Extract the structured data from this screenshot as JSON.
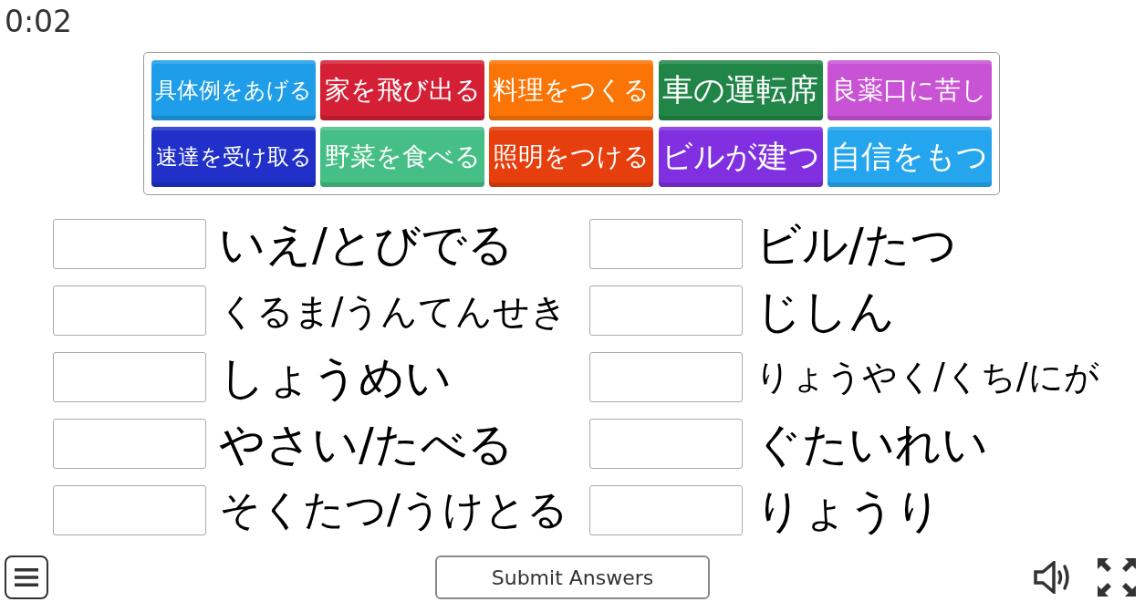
{
  "timer": "0:02",
  "tiles": [
    {
      "label": "具体例をあげる",
      "color": "#1e9de8"
    },
    {
      "label": "家を飛び出る",
      "color": "#d41f35"
    },
    {
      "label": "料理をつくる",
      "color": "#fb7406"
    },
    {
      "label": "車の運転席",
      "color": "#218548"
    },
    {
      "label": "良薬口に苦し",
      "color": "#c853d4"
    },
    {
      "label": "速達を受け取る",
      "color": "#2030c8"
    },
    {
      "label": "野菜を食べる",
      "color": "#45bf85"
    },
    {
      "label": "照明をつける",
      "color": "#e63e0c"
    },
    {
      "label": "ビルが建つ",
      "color": "#8030e0"
    },
    {
      "label": "自信をもつ",
      "color": "#25a5ee"
    }
  ],
  "answers": [
    {
      "label": "いえ/とびでる"
    },
    {
      "label": "くるま/うんてんせき"
    },
    {
      "label": "しょうめい"
    },
    {
      "label": "やさい/たべる"
    },
    {
      "label": "そくたつ/うけとる"
    },
    {
      "label": "ビル/たつ"
    },
    {
      "label": "じしん"
    },
    {
      "label": "りょうやく/くち/にが"
    },
    {
      "label": "ぐたいれい"
    },
    {
      "label": "りょうり"
    }
  ],
  "submit_button": "Submit Answers"
}
